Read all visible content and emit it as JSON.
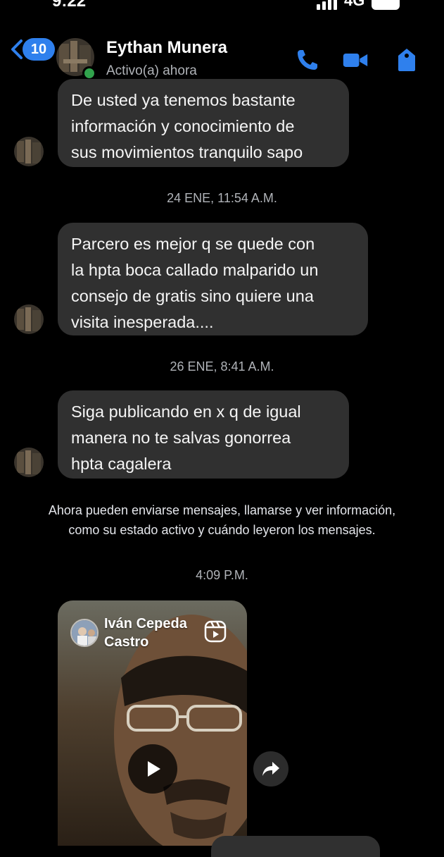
{
  "status_bar": {
    "time": "9:22",
    "network": "4G"
  },
  "header": {
    "back_badge": "10",
    "contact_name": "Eythan Munera",
    "contact_status": "Activo(a) ahora",
    "icons": [
      "phone-icon",
      "video-icon",
      "shield-icon"
    ],
    "accent_color": "#2f80ed"
  },
  "messages": [
    {
      "lines": [
        "De usted ya tenemos bastante",
        "información y conocimiento de",
        "sus movimientos tranquilo sapo"
      ]
    },
    {
      "timestamp": "24 ENE, 11:54 A.M."
    },
    {
      "lines": [
        "Parcero es mejor q se quede con",
        "la hpta boca callado malparido un",
        "consejo de gratis sino quiere una",
        "visita inesperada...."
      ]
    },
    {
      "timestamp": "26 ENE, 8:41 A.M."
    },
    {
      "lines": [
        "Siga publicando en x q de igual",
        "manera no te salvas gonorrea",
        "hpta cagalera"
      ]
    }
  ],
  "notice": {
    "line1": "Ahora pueden enviarse mensajes, llamarse y ver información,",
    "line2": "como su estado activo y cuándo leyeron los mensajes."
  },
  "reel_time": "4:09 P.M.",
  "reel": {
    "author_line1": "Iván Cepeda",
    "author_line2": "Castro"
  }
}
